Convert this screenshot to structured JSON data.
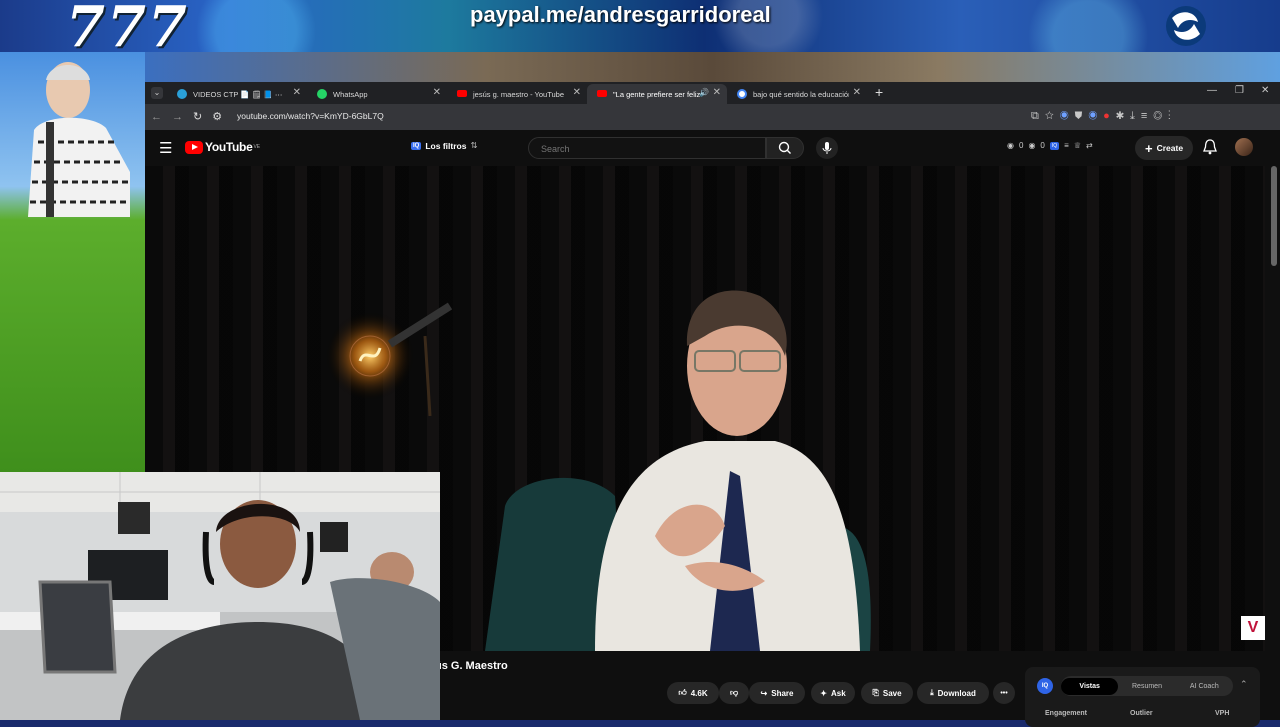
{
  "overlay": {
    "number": "777",
    "paypal": "paypal.me/andresgarridoreal"
  },
  "browser": {
    "tabs": [
      {
        "label": "VIDEOS CTP 📄 🗒 📘 ⋯",
        "favicon_color": "#2aa0d8"
      },
      {
        "label": "WhatsApp",
        "favicon_color": "#25d366"
      },
      {
        "label": "jesús g. maestro - YouTube",
        "favicon_color": "#ff0000"
      },
      {
        "label": "\"La gente prefiere ser feliz",
        "favicon_color": "#ff0000"
      },
      {
        "label": "bajo qué sentido la educación",
        "favicon_color": "#ffffff"
      }
    ],
    "url": "youtube.com/watch?v=KmYD-6GbL7Q"
  },
  "youtube": {
    "logo_text": "YouTube",
    "logo_region": "VE",
    "filters_badge": "IQ",
    "filters_label": "Los filtros",
    "search_placeholder": "Search",
    "stat_a": "0",
    "stat_b": "0",
    "create_label": "Create",
    "channel_title": "ús G. Maestro",
    "like_count": "4.6K",
    "share_label": "Share",
    "ask_label": "Ask",
    "save_label": "Save",
    "download_label": "Download",
    "more_label": "•••"
  },
  "iq_panel": {
    "badge": "IQ",
    "tabs": [
      "Vistas",
      "Resumen",
      "AI Coach"
    ],
    "columns": [
      "Engagement",
      "Outlier",
      "VPH"
    ]
  },
  "video_overlay_logo": "V"
}
